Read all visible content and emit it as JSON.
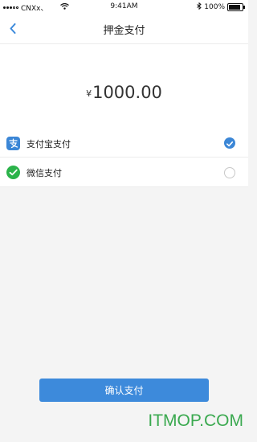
{
  "status_bar": {
    "carrier": "CNXx、",
    "time": "9:41AM",
    "battery_text": "100%",
    "battery_level": 1.0
  },
  "nav": {
    "title": "押金支付"
  },
  "payment": {
    "currency_symbol": "¥",
    "amount": "1000.00"
  },
  "methods": [
    {
      "label": "支付宝支付",
      "icon": "alipay-icon",
      "selected": true
    },
    {
      "label": "微信支付",
      "icon": "wechat-icon",
      "selected": false
    }
  ],
  "confirm_label": "确认支付",
  "watermark": "ITMOP.COM",
  "colors": {
    "accent": "#3d8adb",
    "alipay": "#3b86d6",
    "wechat": "#2bb34a",
    "watermark": "#3aa94f"
  }
}
